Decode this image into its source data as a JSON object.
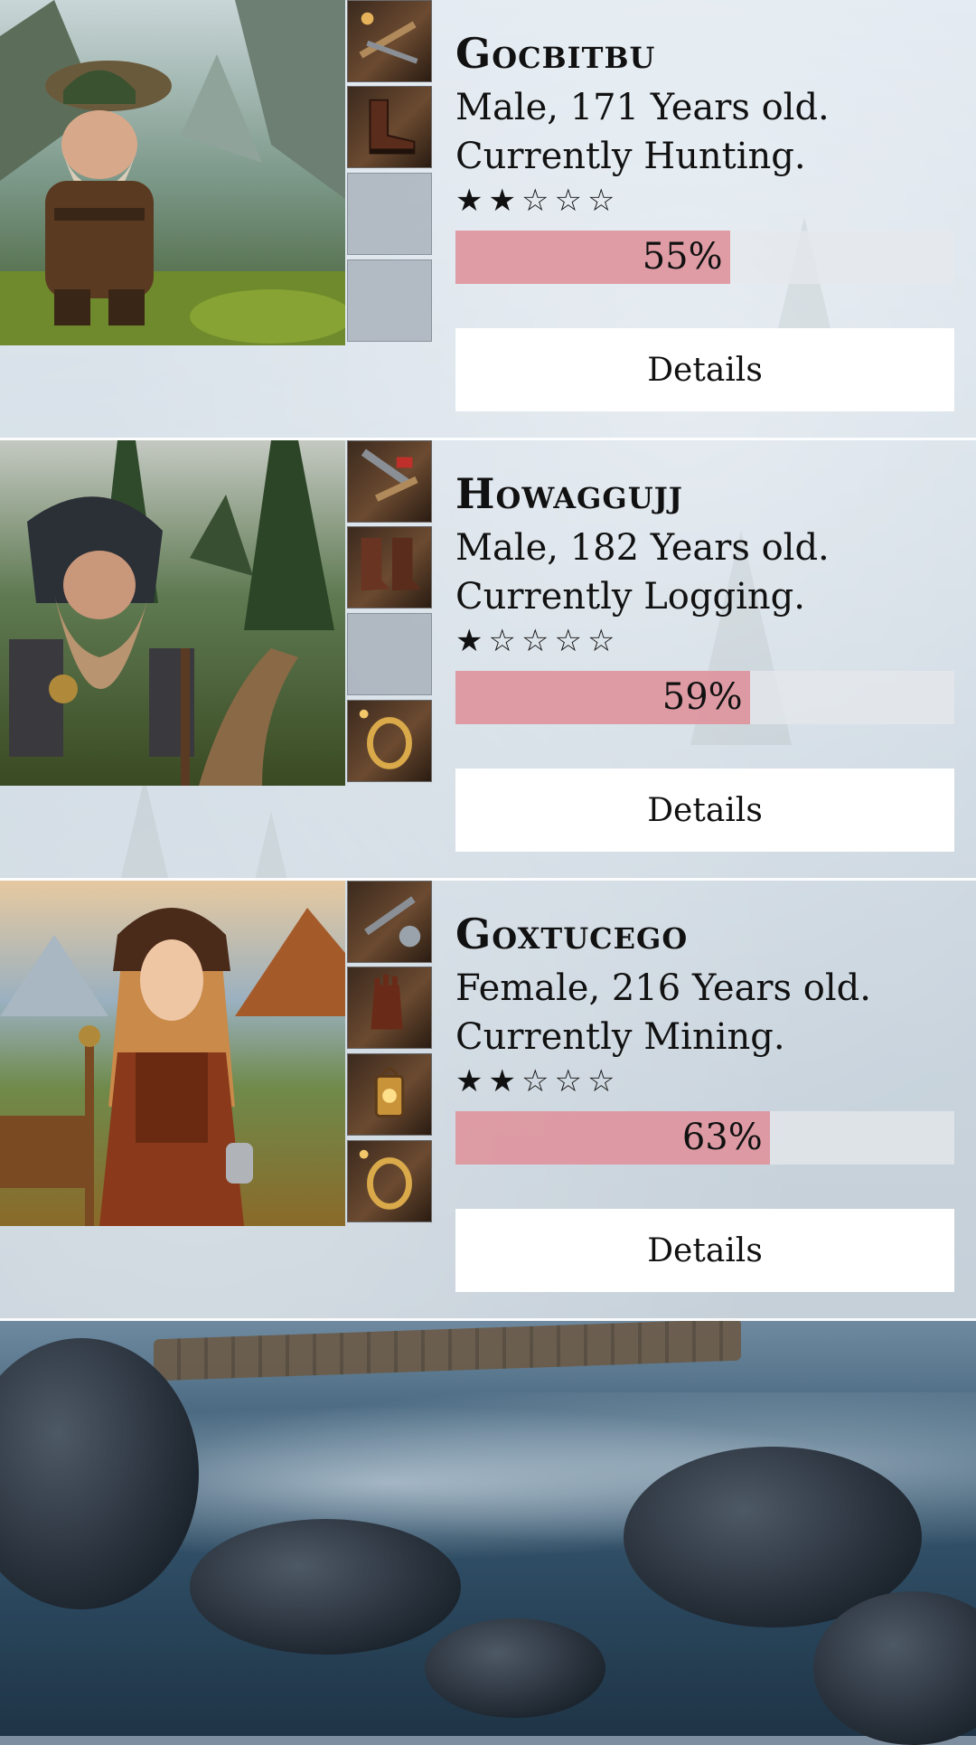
{
  "characters": [
    {
      "name": "Gocbitbu",
      "age_line": "Male, 171 Years old.",
      "activity_line": "Currently Hunting.",
      "rating": 2,
      "rating_max": 5,
      "progress_percent": 55,
      "progress_label": "55%",
      "details_label": "Details",
      "portrait": "bearded-dwarf-mountain-valley",
      "equipment": [
        "tools-icon",
        "boots-icon",
        "empty",
        "empty"
      ]
    },
    {
      "name": "Howaggujj",
      "age_line": "Male, 182 Years old.",
      "activity_line": "Currently Logging.",
      "rating": 1,
      "rating_max": 5,
      "progress_percent": 59,
      "progress_label": "59%",
      "details_label": "Details",
      "portrait": "hooded-dwarf-forest-path",
      "equipment": [
        "tools-icon",
        "boots-icon",
        "empty",
        "ring-icon"
      ]
    },
    {
      "name": "Goxtucego",
      "age_line": "Female, 216 Years old.",
      "activity_line": "Currently Mining.",
      "rating": 2,
      "rating_max": 5,
      "progress_percent": 63,
      "progress_label": "63%",
      "details_label": "Details",
      "portrait": "elf-woman-valley-village",
      "equipment": [
        "tools-icon",
        "gloves-icon",
        "lantern-icon",
        "ring-icon"
      ]
    }
  ],
  "colors": {
    "progress_fill": "#dc828c",
    "progress_track": "#e6e8ec",
    "button_bg": "#ffffff"
  }
}
